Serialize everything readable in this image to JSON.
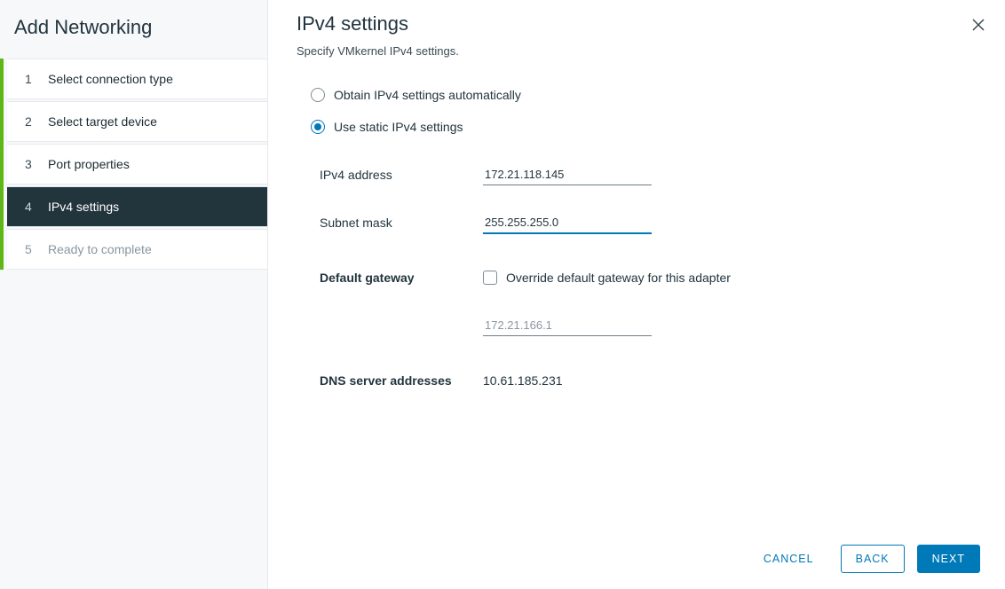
{
  "sidebar": {
    "title": "Add Networking",
    "steps": [
      {
        "num": "1",
        "label": "Select connection type",
        "state": "done"
      },
      {
        "num": "2",
        "label": "Select target device",
        "state": "done"
      },
      {
        "num": "3",
        "label": "Port properties",
        "state": "done"
      },
      {
        "num": "4",
        "label": "IPv4 settings",
        "state": "active"
      },
      {
        "num": "5",
        "label": "Ready to complete",
        "state": "disabled"
      }
    ]
  },
  "main": {
    "title": "IPv4 settings",
    "subtitle": "Specify VMkernel IPv4 settings.",
    "radios": {
      "auto": {
        "label": "Obtain IPv4 settings automatically",
        "selected": false
      },
      "static": {
        "label": "Use static IPv4 settings",
        "selected": true
      }
    },
    "fields": {
      "ipv4_label": "IPv4 address",
      "ipv4_value": "172.21.118.145",
      "subnet_label": "Subnet mask",
      "subnet_value": "255.255.255.0",
      "gw_label": "Default gateway",
      "gw_override_label": "Override default gateway for this adapter",
      "gw_override_checked": false,
      "gw_value": "172.21.166.1",
      "dns_label": "DNS server addresses",
      "dns_value": "10.61.185.231"
    },
    "buttons": {
      "cancel": "CANCEL",
      "back": "BACK",
      "next": "NEXT"
    }
  },
  "icons": {
    "close": "close-icon"
  },
  "colors": {
    "accent": "#0079b8",
    "progress": "#5eb715",
    "active_step_bg": "#22343c"
  }
}
